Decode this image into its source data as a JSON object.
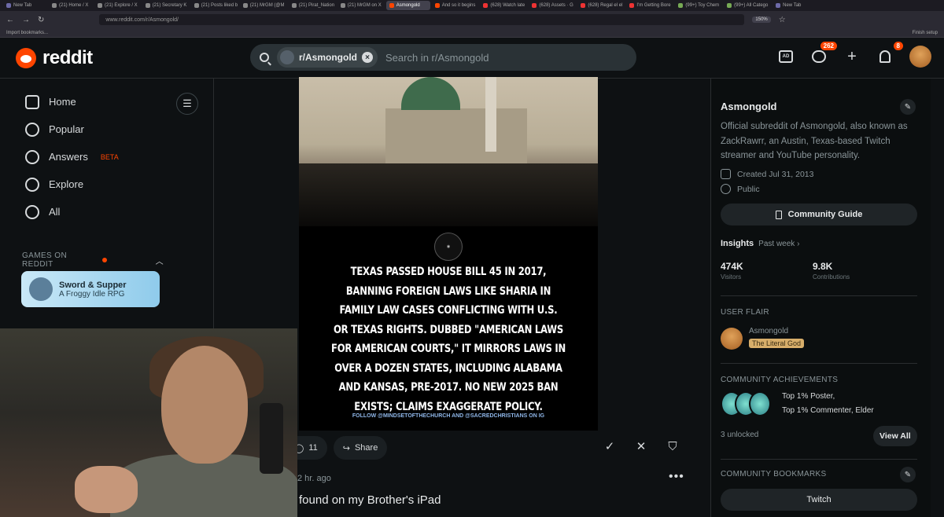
{
  "browser": {
    "tabs": [
      {
        "label": "New Tab",
        "fav": "#6d6aa8"
      },
      {
        "label": "(21) Home / X",
        "fav": "#888"
      },
      {
        "label": "(21) Explore / X",
        "fav": "#888"
      },
      {
        "label": "(21) Secretary K",
        "fav": "#888"
      },
      {
        "label": "(21) Posts liked b",
        "fav": "#888"
      },
      {
        "label": "(21) MrGM (@M",
        "fav": "#888"
      },
      {
        "label": "(21) Pirat_Nation",
        "fav": "#888"
      },
      {
        "label": "(21) MrGM on X",
        "fav": "#888"
      },
      {
        "label": "Asmongold",
        "fav": "#ff4500",
        "active": true
      },
      {
        "label": "And so it begins",
        "fav": "#ff4500"
      },
      {
        "label": "(628) Watch late",
        "fav": "#e33"
      },
      {
        "label": "(628) Assets · G",
        "fav": "#e33"
      },
      {
        "label": "(628) Regal el el",
        "fav": "#e33"
      },
      {
        "label": "I'm Getting Bore",
        "fav": "#e33"
      },
      {
        "label": "(99+) Toy Chem",
        "fav": "#7a5"
      },
      {
        "label": "(99+) All Catego",
        "fav": "#7a5"
      },
      {
        "label": "New Tab",
        "fav": "#6d6aa8"
      }
    ],
    "url": "www.reddit.com/r/Asmongold/",
    "zoom": "150%",
    "bookmarks_left": "Import bookmarks...",
    "bookmarks_right": "Finish setup"
  },
  "header": {
    "logo_text": "reddit",
    "search_chip": "r/Asmongold",
    "search_placeholder": "Search in r/Asmongold",
    "ad_label": "AD",
    "chat_badge": "262",
    "notif_badge": "8"
  },
  "sidebar": {
    "items": [
      {
        "label": "Home",
        "icon": "home-icon"
      },
      {
        "label": "Popular",
        "icon": "popular-icon"
      },
      {
        "label": "Answers",
        "icon": "answers-icon",
        "beta": "BETA"
      },
      {
        "label": "Explore",
        "icon": "explore-icon"
      },
      {
        "label": "All",
        "icon": "all-icon"
      }
    ],
    "games_header": "GAMES ON REDDIT",
    "game": {
      "title": "Sword & Supper",
      "subtitle": "A Froggy Idle RPG"
    }
  },
  "post": {
    "image_caption": "Texas passed House Bill 45 in 2017, banning foreign laws like Sharia in family law cases conflicting with U.S. or Texas rights. Dubbed \"American Laws for American Courts,\" it mirrors laws in over a dozen states, including Alabama and Kansas, pre-2017. No new 2025 ban exists; claims exaggerate policy.",
    "follow_text": "FOLLOW @MINDSETOFTHECHURCH AND @SACREDCHRISTIANS ON IG",
    "comments": "11",
    "share_label": "Share",
    "time": "2 hr. ago",
    "next_title": "found on my Brother's iPad"
  },
  "community": {
    "name": "Asmongold",
    "description": "Official subreddit of Asmongold, also known as ZackRawrr, an Austin, Texas-based Twitch streamer and YouTube personality.",
    "created": "Created Jul 31, 2013",
    "visibility": "Public",
    "guide_label": "Community Guide",
    "insights_label": "Insights",
    "insights_period": "Past week ›",
    "visitors_value": "474K",
    "visitors_label": "Visitors",
    "contrib_value": "9.8K",
    "contrib_label": "Contributions",
    "flair_header": "USER FLAIR",
    "flair_user": "Asmongold",
    "flair_tag": "The Literal God",
    "achievements_header": "COMMUNITY ACHIEVEMENTS",
    "achievement_line1": "Top 1% Poster,",
    "achievement_line2": "Top 1% Commenter, Elder",
    "unlocked": "3 unlocked",
    "view_all": "View All",
    "bookmarks_header": "COMMUNITY BOOKMARKS",
    "bookmark_twitch": "Twitch"
  }
}
